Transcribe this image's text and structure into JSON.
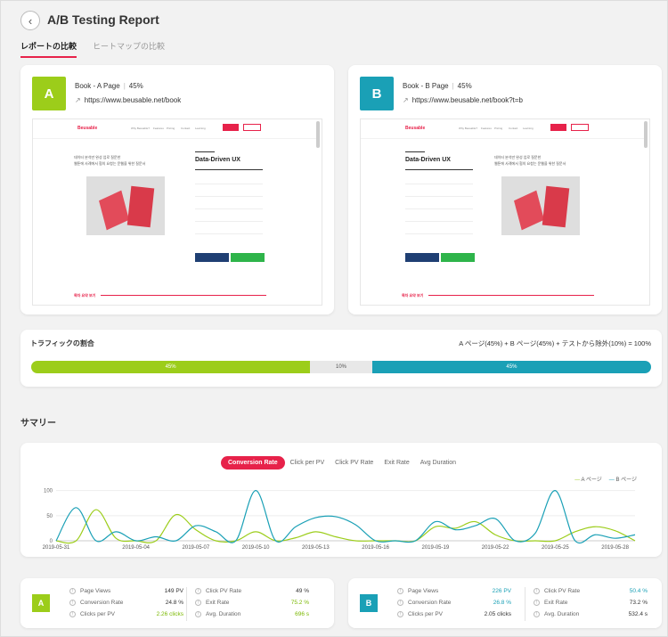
{
  "header": {
    "back_icon": "chevron-left-icon",
    "title": "A/B Testing Report",
    "tabs": [
      {
        "label": "レポートの比較",
        "active": true
      },
      {
        "label": "ヒートマップの比較",
        "active": false
      }
    ],
    "accent_color": "#e7224a"
  },
  "pages": [
    {
      "badge": "A",
      "color": "#9ccd1a",
      "name": "Book - A Page",
      "share": "45%",
      "url": "https://www.beusable.net/book",
      "preview": {
        "logo": "Beusable",
        "menu": [
          "Why Beusable?",
          "Features",
          "Pricing",
          "Contact",
          "Learning"
        ],
        "heading": "Data-Driven UX",
        "intro": [
          "데이터 분석만 완성 업로 질문한",
          "웹툰에 사례에서 협의 요청는 문웹을 위한 질문서"
        ],
        "footer": "목차 요약 보기"
      }
    },
    {
      "badge": "B",
      "color": "#1aa0b6",
      "name": "Book - B Page",
      "share": "45%",
      "url": "https://www.beusable.net/book?t=b",
      "preview": {
        "logo": "Beusable",
        "menu": [
          "Why Beusable?",
          "Features",
          "Pricing",
          "Contact",
          "Learning"
        ],
        "heading": "Data-Driven UX",
        "intro": [
          "데이터 분석만 완성 업로 질문한",
          "웹툰에 사례에서 협의 요청는 문웹을 위한 질문서"
        ],
        "footer": "목차 요약 보기"
      }
    }
  ],
  "traffic": {
    "title": "トラフィックの割合",
    "formula": "A ページ(45%) + B ページ(45%) + テストから除外(10%) = 100%",
    "segments": [
      {
        "label": "45%",
        "share": 45,
        "color": "#9ccd1a"
      },
      {
        "label": "10%",
        "share": 10,
        "color": "#e8e8e8"
      },
      {
        "label": "45%",
        "share": 45,
        "color": "#1aa0b6"
      }
    ]
  },
  "summary": {
    "title": "サマリー",
    "metric_tabs": [
      {
        "label": "Conversion Rate",
        "active": true
      },
      {
        "label": "Click per PV",
        "active": false
      },
      {
        "label": "Click PV Rate",
        "active": false
      },
      {
        "label": "Exit Rate",
        "active": false
      },
      {
        "label": "Avg Duration",
        "active": false
      }
    ],
    "legend": [
      {
        "marker": "—",
        "label": "A ページ"
      },
      {
        "marker": "—",
        "label": "B ページ"
      }
    ]
  },
  "chart_data": {
    "type": "line",
    "x": [
      "2019-05-31",
      "2019-06-01",
      "2019-06-02",
      "2019-06-03",
      "2019-05-04",
      "2019-05-05",
      "2019-05-06",
      "2019-05-07",
      "2019-05-08",
      "2019-05-09",
      "2019-05-10",
      "2019-05-11",
      "2019-05-12",
      "2019-05-13",
      "2019-05-14",
      "2019-05-15",
      "2019-05-16",
      "2019-05-17",
      "2019-05-18",
      "2019-05-19",
      "2019-05-20",
      "2019-05-21",
      "2019-05-22",
      "2019-05-23",
      "2019-05-24",
      "2019-05-25",
      "2019-05-26",
      "2019-05-27",
      "2019-05-28",
      "2019-05-29"
    ],
    "tick_labels": [
      "2019-05-31",
      "2019-05-04",
      "2019-05-07",
      "2019-05-10",
      "2019-05-13",
      "2019-05-16",
      "2019-05-19",
      "2019-05-22",
      "2019-05-25",
      "2019-05-28"
    ],
    "ylim": [
      0,
      110
    ],
    "yticks": [
      0,
      50,
      100
    ],
    "series": [
      {
        "name": "A ページ",
        "color": "#9ccd1a",
        "values": [
          0,
          0,
          62,
          5,
          0,
          0,
          52,
          22,
          0,
          0,
          18,
          0,
          6,
          18,
          8,
          0,
          0,
          0,
          0,
          28,
          25,
          38,
          12,
          0,
          0,
          0,
          18,
          28,
          20,
          0
        ]
      },
      {
        "name": "B ページ",
        "color": "#1aa0b6",
        "values": [
          0,
          66,
          0,
          18,
          0,
          8,
          0,
          30,
          18,
          0,
          100,
          0,
          28,
          46,
          48,
          32,
          0,
          0,
          0,
          38,
          22,
          30,
          44,
          0,
          15,
          100,
          0,
          12,
          5,
          12
        ]
      }
    ]
  },
  "stats": [
    {
      "badge": "A",
      "color": "#9ccd1a",
      "left": [
        {
          "label": "Page Views",
          "value": "149 PV",
          "highlight": false
        },
        {
          "label": "Conversion Rate",
          "value": "24.8 %",
          "highlight": false
        },
        {
          "label": "Clicks per PV",
          "value": "2.26 clicks",
          "highlight": true
        }
      ],
      "right": [
        {
          "label": "Click PV Rate",
          "value": "49 %",
          "highlight": false
        },
        {
          "label": "Exit Rate",
          "value": "75.2 %",
          "highlight": true
        },
        {
          "label": "Avg. Duration",
          "value": "696 s",
          "highlight": true
        }
      ]
    },
    {
      "badge": "B",
      "color": "#1aa0b6",
      "left": [
        {
          "label": "Page Views",
          "value": "226 PV",
          "highlight": true
        },
        {
          "label": "Conversion Rate",
          "value": "26.8 %",
          "highlight": true
        },
        {
          "label": "Clicks per PV",
          "value": "2.05 clicks",
          "highlight": false
        }
      ],
      "right": [
        {
          "label": "Click PV Rate",
          "value": "50.4 %",
          "highlight": true
        },
        {
          "label": "Exit Rate",
          "value": "73.2 %",
          "highlight": false
        },
        {
          "label": "Avg. Duration",
          "value": "532.4 s",
          "highlight": false
        }
      ]
    }
  ]
}
